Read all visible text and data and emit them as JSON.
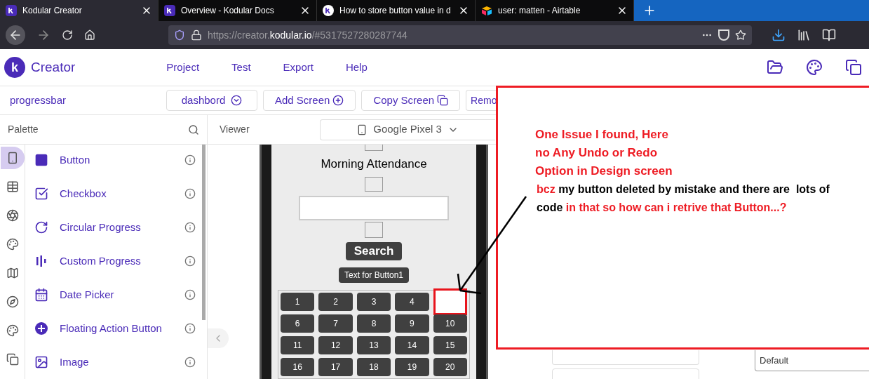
{
  "browser": {
    "tabs": [
      {
        "title": "Kodular Creator",
        "selected": true,
        "kind": "kodular"
      },
      {
        "title": "Overview - Kodular Docs",
        "selected": false,
        "kind": "kodular"
      },
      {
        "title": "How to store button value in d",
        "selected": false,
        "kind": "community"
      },
      {
        "title": "user: matten - Airtable",
        "selected": false,
        "kind": "airtable"
      }
    ],
    "url": [
      "https://creator.",
      "kodular.io",
      "/#5317527280287744"
    ]
  },
  "app": {
    "logo": "k",
    "name": "Creator",
    "menu": [
      "Project",
      "Test",
      "Export",
      "Help"
    ]
  },
  "toolbar": {
    "project": "progressbar",
    "screen": "dashbord",
    "buttons": [
      {
        "label": "Add Screen",
        "kind": "add"
      },
      {
        "label": "Copy Screen",
        "kind": "copy"
      },
      {
        "label": "Remo",
        "kind": "plain"
      }
    ]
  },
  "palette": {
    "title": "Palette",
    "categories": [
      {
        "selected": true
      },
      {
        "selected": false
      },
      {
        "selected": false
      },
      {
        "selected": false
      },
      {
        "selected": false
      },
      {
        "selected": false
      },
      {
        "selected": false
      },
      {
        "selected": false
      }
    ],
    "items": [
      "Button",
      "Checkbox",
      "Circular Progress",
      "Custom Progress",
      "Date Picker",
      "Floating Action Button",
      "Image"
    ]
  },
  "viewer": {
    "title": "Viewer",
    "device": "Google Pixel 3",
    "phone": {
      "heading": "Morning Attendance",
      "search": "Search",
      "label_button": "Text for Button1",
      "grid": [
        {
          "kind": "button",
          "label": "1"
        },
        {
          "kind": "button",
          "label": "2"
        },
        {
          "kind": "button",
          "label": "3"
        },
        {
          "kind": "button",
          "label": "4"
        },
        {
          "kind": "marked"
        },
        {
          "kind": "button",
          "label": "6"
        },
        {
          "kind": "button",
          "label": "7"
        },
        {
          "kind": "button",
          "label": "8"
        },
        {
          "kind": "button",
          "label": "9"
        },
        {
          "kind": "button",
          "label": "10"
        },
        {
          "kind": "button",
          "label": "11"
        },
        {
          "kind": "button",
          "label": "12"
        },
        {
          "kind": "button",
          "label": "13"
        },
        {
          "kind": "button",
          "label": "14"
        },
        {
          "kind": "button",
          "label": "15"
        },
        {
          "kind": "button",
          "label": "16"
        },
        {
          "kind": "button",
          "label": "17"
        },
        {
          "kind": "button",
          "label": "18"
        },
        {
          "kind": "button",
          "label": "19"
        },
        {
          "kind": "button",
          "label": "20"
        }
      ]
    }
  },
  "properties": {
    "field_value": "Default"
  },
  "annotation": {
    "lines": [
      "One Issue I found, Here",
      "no Any Undo or Redo",
      "Option in Design screen"
    ],
    "paragraph": [
      {
        "text": "bcz ",
        "color": "#ee1c24"
      },
      {
        "text": "my button deleted by mistake and there are  lots of code ",
        "color": "#000000"
      },
      {
        "text": "in that so how can i retrive that Button...?",
        "color": "#ee1c24"
      }
    ]
  }
}
